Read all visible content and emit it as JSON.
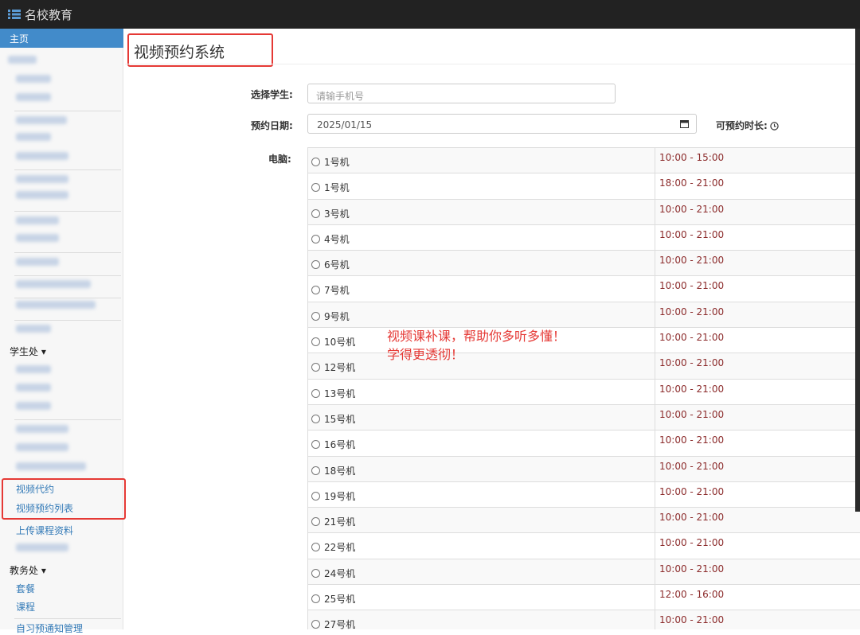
{
  "app": {
    "brand": "名校教育"
  },
  "sidebar": {
    "home": "主页",
    "student_section": "学生处 ▾",
    "student_items": [
      "视频代约",
      "视频预约列表",
      "上传课程资料"
    ],
    "academic_section": "教务处 ▾",
    "academic_items": [
      "套餐",
      "课程",
      "自习预通知管理"
    ]
  },
  "page": {
    "title": "视频预约系统",
    "student_label": "选择学生:",
    "student_placeholder": "请输手机号",
    "date_label": "预约日期:",
    "date_value": "2025/01/15",
    "duration_label": "可预约时长:",
    "computer_label": "电脑:"
  },
  "machines": [
    {
      "name": "1号机",
      "time": "10:00 - 15:00"
    },
    {
      "name": "1号机",
      "time": "18:00 - 21:00"
    },
    {
      "name": "3号机",
      "time": "10:00 - 21:00"
    },
    {
      "name": "4号机",
      "time": "10:00 - 21:00"
    },
    {
      "name": "6号机",
      "time": "10:00 - 21:00"
    },
    {
      "name": "7号机",
      "time": "10:00 - 21:00"
    },
    {
      "name": "9号机",
      "time": "10:00 - 21:00"
    },
    {
      "name": "10号机",
      "time": "10:00 - 21:00"
    },
    {
      "name": "12号机",
      "time": "10:00 - 21:00"
    },
    {
      "name": "13号机",
      "time": "10:00 - 21:00"
    },
    {
      "name": "15号机",
      "time": "10:00 - 21:00"
    },
    {
      "name": "16号机",
      "time": "10:00 - 21:00"
    },
    {
      "name": "18号机",
      "time": "10:00 - 21:00"
    },
    {
      "name": "19号机",
      "time": "10:00 - 21:00"
    },
    {
      "name": "21号机",
      "time": "10:00 - 21:00"
    },
    {
      "name": "22号机",
      "time": "10:00 - 21:00"
    },
    {
      "name": "24号机",
      "time": "10:00 - 21:00"
    },
    {
      "name": "25号机",
      "time": "12:00 - 16:00"
    },
    {
      "name": "27号机",
      "time": "10:00 - 21:00"
    }
  ],
  "annotation": {
    "line1": "视频课补课，帮助你多听多懂！",
    "line2": "学得更透彻！"
  },
  "colors": {
    "topbar": "#222222",
    "sidebar_active": "#428bca",
    "link": "#337ab7",
    "time_text": "#8b2a2a",
    "highlight_red": "#e53935"
  },
  "icons": {
    "brand": "list-icon",
    "date": "calendar-icon",
    "duration": "clock-icon",
    "machine": "radio-button"
  }
}
